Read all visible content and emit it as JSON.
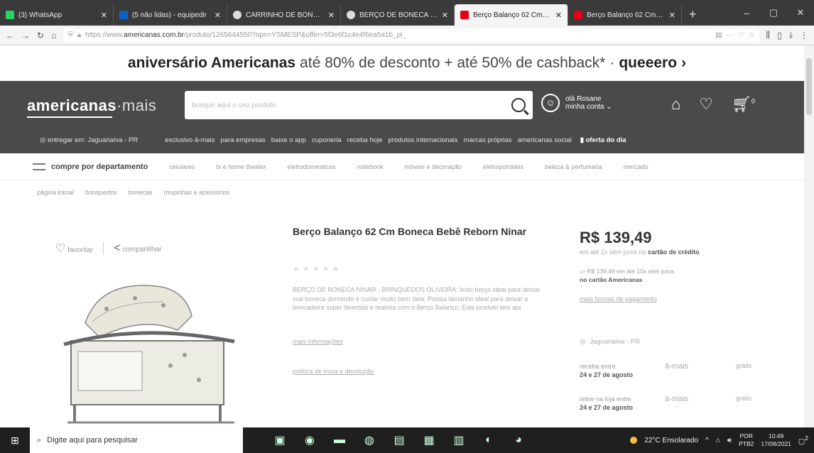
{
  "browser": {
    "tabs": [
      {
        "title": "(3) WhatsApp",
        "active": false
      },
      {
        "title": "(5 não lidas) - equipedir",
        "active": false
      },
      {
        "title": "CARRINHO DE BONECA",
        "active": false
      },
      {
        "title": "BERÇO DE BONECA Fo...",
        "active": false
      },
      {
        "title": "Berço Balanço 62 Cm B...",
        "active": true
      },
      {
        "title": "Berço Balanço 62 Cm B...",
        "active": false
      }
    ],
    "new_tab": "+",
    "url_prefix": "https://www.",
    "url_domain": "americanas.com.br",
    "url_rest": "/produto/1265644550?opn=YSMESP&offer=5f3e6f1c4e4f6ea5a1b_pl_",
    "address_icons": [
      "reader-icon",
      "more-icon",
      "pocket-icon",
      "star-icon"
    ],
    "toolbar_icons": [
      "library-icon",
      "sidebar-icon",
      "download-icon",
      "extensions-icon"
    ]
  },
  "promo": {
    "text_a": "aniversário Americanas",
    "text_b": "até 80% de desconto + até 50% de cashback*",
    "dot": "·",
    "cta": "queeero",
    "arrow": "›"
  },
  "header": {
    "logo": "americanas",
    "logo_suffix": "·mais",
    "search_placeholder": "busque aqui o seu produto",
    "greeting": "olá Rosane",
    "account_label": "minha conta",
    "cart_count": "0"
  },
  "nav": {
    "location": "entregar em: Jaguariaíva - PR",
    "items": [
      "exclusivo ā-mais",
      "para empresas",
      "baixe o app",
      "cuponeria",
      "receba hoje",
      "produtos internacionais",
      "marcas próprias",
      "americanas social"
    ],
    "deal": "oferta do dia"
  },
  "categories": {
    "dept": "compre por departamento",
    "items": [
      "celulares",
      "tv e home theater",
      "eletrodomésticos",
      "notebook",
      "móveis e decoração",
      "eletroportáteis",
      "beleza & perfumaria",
      "mercado"
    ]
  },
  "breadcrumb": [
    "página inicial",
    "brinquedos",
    "bonecas",
    "roupinhas e acessórios"
  ],
  "product": {
    "favorite": "favoritar",
    "share": "compartilhar",
    "title": "Berço Balanço 62 Cm Boneca Bebê Reborn Ninar",
    "stars": "★★★★★",
    "description": "BERÇO DE BONECA NINAR - BRINQUEDOS OLIVEIRA: lindo berço ideal para deixar sua boneca dormindo e cuidar muito bem dela. Possui tamanho ideal para deixar a brincadeira super divertida e realista com o Berço Balanço. Este produto tem apr",
    "more_info": "mais informações",
    "returns": "política de troca e devolução"
  },
  "pricing": {
    "price": "R$ 139,49",
    "installments_a": "em até 1x sem juros no",
    "installments_b": "cartão de crédito",
    "card_line_a": "R$ 139,49 em até 10x sem juros",
    "card_line_b": "no cartão Americanas",
    "payment_link": "mais formas de pagamento",
    "ship_to": "Jaguariaíva - PR",
    "shipping": [
      {
        "label": "receba entre",
        "dates": "24 e 27 de agosto",
        "tier": "ā-mais",
        "cost": "grátis"
      },
      {
        "label": "retire na loja entre",
        "dates": "24 e 27 de agosto",
        "tier": "ā-mais",
        "cost": "grátis"
      }
    ]
  },
  "taskbar": {
    "search_placeholder": "Digite aqui para pesquisar",
    "weather": "22°C  Ensolarado",
    "lang_a": "POR",
    "lang_b": "PTB2",
    "time": "10:49",
    "date": "17/08/2021",
    "notifications": "2"
  }
}
